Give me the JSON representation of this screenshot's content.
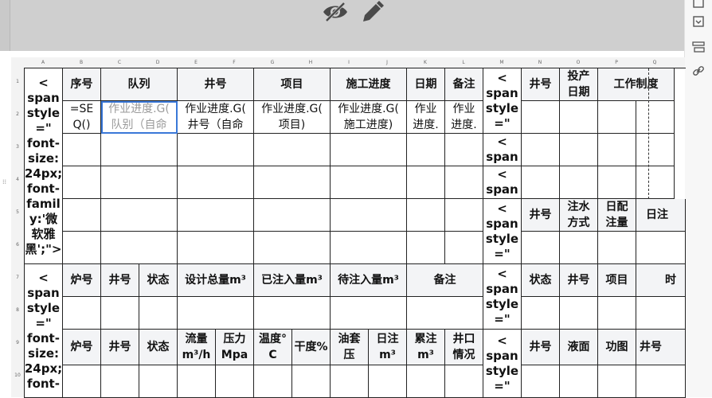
{
  "toolbar": {
    "icons": [
      "eye-slash-icon",
      "pencil-icon"
    ],
    "side_icons": [
      "panel-icon",
      "dropdown-box-icon",
      "table-layout-icon",
      "link-icon"
    ]
  },
  "columns": [
    "A",
    "B",
    "C",
    "D",
    "E",
    "F",
    "G",
    "H",
    "I",
    "J",
    "K",
    "L",
    "M",
    "N",
    "O",
    "P",
    "Q"
  ],
  "rows": [
    "1",
    "2",
    "3",
    "4",
    "5",
    "6",
    "7",
    "8",
    "9",
    "10"
  ],
  "span_text_a": "<\nspan\nstyle\n=\"\nfont-\nsize:\n24px;\nfont-\nfamil\ny:'微\n软雅\n黑';\">",
  "span_text_a2": "<\nspan\nstyle\n=\"\nfont-\nsize:\n24px;\nfont-",
  "span_m1": "<\nspan\nstyle\n=\"",
  "span_m3": "<\nspan",
  "span_m4": "<\nspan",
  "span_m5": "<\nspan\nstyle\n=\"",
  "span_m7": "<\nspan\nstyle\n=\"",
  "span_m9": "<\nspan\nstyle\n=\"",
  "table1": {
    "h_seq": "序号",
    "h_team": "队列",
    "h_well": "井号",
    "h_project": "项目",
    "h_progress": "施工进度",
    "h_date": "日期",
    "h_note": "备注",
    "r2_seq": "=SE\nQ()",
    "r2_team": "作业进度.G(\n队别（自命",
    "r2_well": "作业进度.G(\n井号（自命",
    "r2_project": "作业进度.G(\n项目)",
    "r2_progress": "作业进度.G(\n施工进度)",
    "r2_date": "作业\n进度.",
    "r2_note": "作业\n进度."
  },
  "table_right1": {
    "h_well": "井号",
    "h_date": "投产\n日期",
    "h_system": "工作制度"
  },
  "table_right2": {
    "h_well": "井号",
    "h_method": "注水\n方式",
    "h_daily": "日配\n注量",
    "h_cut": "日注"
  },
  "table2": {
    "h_pool": "炉号",
    "h_well": "井号",
    "h_status": "状态",
    "h_total": "设计总量m³",
    "h_injected": "已注入量m³",
    "h_pending": "待注入量m³",
    "h_note": "备注"
  },
  "table_right3": {
    "h_status": "状态",
    "h_well": "井号",
    "h_project": "项目",
    "h_cut": "时"
  },
  "table3": {
    "h_pool": "炉号",
    "h_well": "井号",
    "h_status": "状态",
    "h_flow": "流量\nm³/h",
    "h_pressure": "压力\nMpa",
    "h_temp": "温度°\nC",
    "h_dry": "干度%",
    "h_casing": "油套\n压",
    "h_daily": "日注\nm³",
    "h_cumulative": "累注\nm³",
    "h_wellhead": "井口\n情况"
  },
  "table_right4": {
    "h_well": "井号",
    "h_level": "液面",
    "h_chart": "功图",
    "h_well2": "井号"
  }
}
